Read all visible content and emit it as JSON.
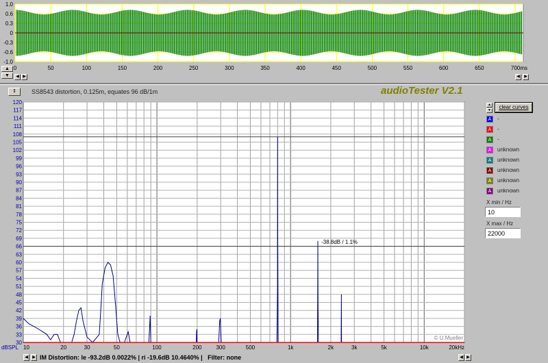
{
  "waveform": {
    "y_ticks": [
      "1.0",
      "0.6",
      "0.3",
      "0",
      "-0.3",
      "-0.6",
      "-1.0"
    ],
    "x_ticks": [
      "0",
      "50",
      "100",
      "150",
      "200",
      "250",
      "300",
      "350",
      "400",
      "450",
      "500",
      "550",
      "600",
      "650",
      "700ms"
    ],
    "colors": {
      "background": "#ffffff",
      "grid": "#ffff00",
      "signal": "#008000"
    }
  },
  "header": {
    "description": "SS8543 distortion, 0.125m, equates 96 dB/1m",
    "app_title": "audioTester V2.1"
  },
  "legend": {
    "clear_button": "clear curves",
    "items": [
      {
        "badge": "A",
        "label": "-",
        "color": "#0000ff"
      },
      {
        "badge": "A",
        "label": "-",
        "color": "#ff0000"
      },
      {
        "badge": "A",
        "label": "-",
        "color": "#008000"
      },
      {
        "badge": "A",
        "label": "unknown",
        "color": "#ff00ff"
      },
      {
        "badge": "A",
        "label": "unknown",
        "color": "#008080"
      },
      {
        "badge": "A",
        "label": "unknown",
        "color": "#800000"
      },
      {
        "badge": "A",
        "label": "unknown",
        "color": "#808000"
      },
      {
        "badge": "A",
        "label": "unknown",
        "color": "#800080"
      }
    ]
  },
  "xrange": {
    "xmin_label": "X min / Hz",
    "xmin_value": "10",
    "xmax_label": "X max / Hz",
    "xmax_value": "22000"
  },
  "status": {
    "text": "IM Distortion: le -93.2dB 0.0022% | ri -19.6dB 10.4640% |   Filter: none"
  },
  "chart_data": {
    "type": "line",
    "xscale": "log",
    "xlim": [
      10,
      20000
    ],
    "ylim": [
      30,
      120
    ],
    "ylabel": "dBSPL",
    "y_ticks": [
      "120",
      "117",
      "114",
      "111",
      "108",
      "105",
      "102",
      "99",
      "96",
      "93",
      "90",
      "87",
      "84",
      "81",
      "78",
      "75",
      "72",
      "69",
      "66",
      "63",
      "60",
      "57",
      "54",
      "51",
      "48",
      "45",
      "42",
      "39",
      "36",
      "33",
      "30"
    ],
    "x_ticks": [
      "10",
      "20",
      "30",
      "50",
      "100",
      "200",
      "300",
      "500",
      "1k",
      "2k",
      "3k",
      "5k",
      "10k",
      "20kHz"
    ],
    "reference_lines": [
      107,
      66
    ],
    "annotation": "-38.8dB / 1.1%",
    "watermark": "© U.Mueller",
    "grid": true,
    "series": [
      {
        "color": "#00008b",
        "points": [
          [
            10,
            39
          ],
          [
            11,
            37
          ],
          [
            12,
            36
          ],
          [
            13,
            35
          ],
          [
            14,
            34
          ],
          [
            15,
            33
          ],
          [
            16,
            31
          ],
          [
            17,
            33
          ],
          [
            18,
            33
          ],
          [
            19,
            30
          ],
          [
            21,
            30
          ],
          [
            23,
            30
          ],
          [
            24,
            33
          ],
          [
            25,
            38
          ],
          [
            26,
            42
          ],
          [
            27,
            43
          ],
          [
            28,
            38
          ],
          [
            30,
            32
          ],
          [
            33,
            30
          ],
          [
            37,
            33
          ],
          [
            38,
            42
          ],
          [
            39,
            52
          ],
          [
            41,
            58
          ],
          [
            43,
            60
          ],
          [
            45,
            59
          ],
          [
            47,
            55
          ],
          [
            49,
            44
          ],
          [
            51,
            33
          ],
          [
            53,
            30
          ],
          [
            57,
            30
          ],
          [
            60,
            33
          ],
          [
            61,
            34
          ],
          [
            63,
            30
          ],
          [
            70,
            30
          ],
          [
            80,
            30
          ],
          [
            87,
            30
          ],
          [
            88,
            35
          ],
          [
            89,
            40
          ],
          [
            90,
            30
          ],
          [
            100,
            30
          ],
          [
            140,
            30
          ],
          [
            180,
            30
          ],
          [
            197,
            30
          ],
          [
            198,
            34
          ],
          [
            199,
            35
          ],
          [
            200,
            30
          ],
          [
            240,
            30
          ],
          [
            290,
            30
          ],
          [
            295,
            38
          ],
          [
            298,
            39
          ],
          [
            300,
            35
          ],
          [
            303,
            30
          ],
          [
            500,
            30
          ],
          [
            700,
            30
          ],
          [
            790,
            30
          ],
          [
            798,
            50
          ],
          [
            800,
            107
          ],
          [
            802,
            69
          ],
          [
            808,
            30
          ],
          [
            1000,
            30
          ],
          [
            1400,
            30
          ],
          [
            1590,
            30
          ],
          [
            1598,
            55
          ],
          [
            1600,
            68
          ],
          [
            1605,
            45
          ],
          [
            1615,
            30
          ],
          [
            2000,
            30
          ],
          [
            2390,
            30
          ],
          [
            2398,
            42
          ],
          [
            2400,
            48
          ],
          [
            2406,
            30
          ],
          [
            5000,
            30
          ],
          [
            10000,
            30
          ],
          [
            20000,
            30
          ]
        ]
      },
      {
        "color": "#ff0000",
        "points": [
          [
            10,
            30
          ],
          [
            20000,
            30
          ]
        ]
      }
    ]
  }
}
